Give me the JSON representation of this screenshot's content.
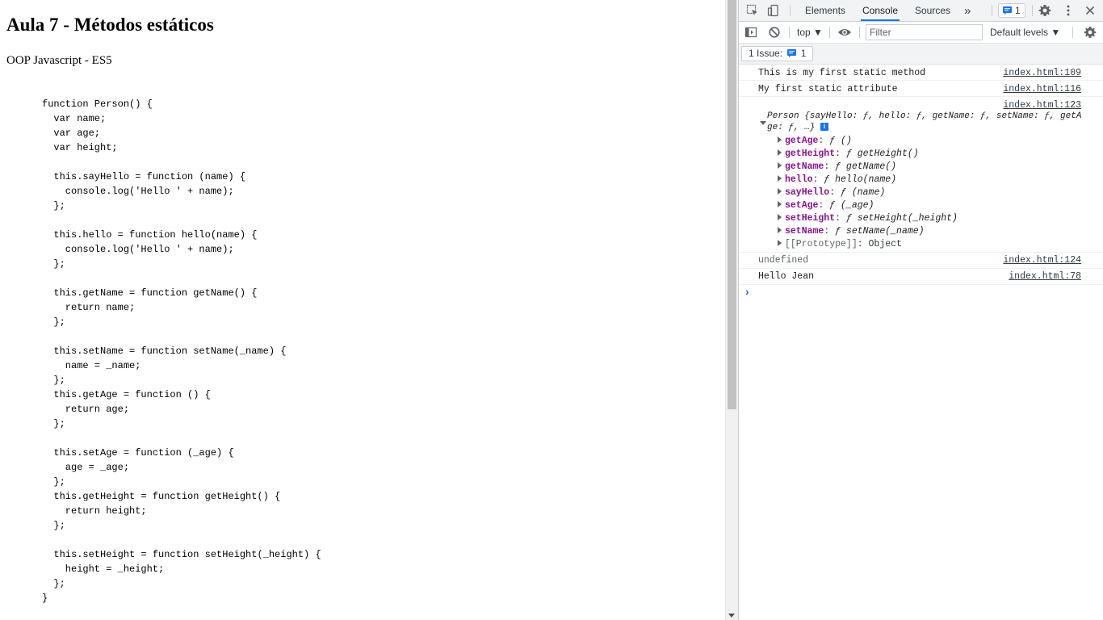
{
  "page": {
    "title": "Aula 7 - Métodos estáticos",
    "subtitle": "OOP Javascript - ES5",
    "code": "function Person() {\n  var name;\n  var age;\n  var height;\n\n  this.sayHello = function (name) {\n    console.log('Hello ' + name);\n  };\n\n  this.hello = function hello(name) {\n    console.log('Hello ' + name);\n  };\n\n  this.getName = function getName() {\n    return name;\n  };\n\n  this.setName = function setName(_name) {\n    name = _name;\n  };\n  this.getAge = function () {\n    return age;\n  };\n\n  this.setAge = function (_age) {\n    age = _age;\n  };\n  this.getHeight = function getHeight() {\n    return height;\n  };\n\n  this.setHeight = function setHeight(_height) {\n    height = _height;\n  };\n}"
  },
  "devtools": {
    "tabs": [
      "Elements",
      "Console",
      "Sources"
    ],
    "active_tab": "Console",
    "more_tabs": "»",
    "issues_badge_count": "1",
    "toolbar": {
      "context": "top ▼",
      "filter_placeholder": "Filter",
      "levels": "Default levels ▼"
    },
    "issues_bar": {
      "label": "1 Issue:",
      "count": "1"
    },
    "console": {
      "messages": [
        {
          "text": "This is my first static method",
          "source": "index.html:109"
        },
        {
          "text": "My first static attribute",
          "source": "index.html:116"
        }
      ],
      "object_message": {
        "source": "index.html:123",
        "summary_line1": "Person {sayHello: ƒ, hello: ƒ, getName: ƒ, setName: ƒ, getA",
        "summary_line2": "ge: ƒ, …}",
        "info_badge": "i",
        "properties": [
          {
            "key": "getAge",
            "value": "ƒ ()"
          },
          {
            "key": "getHeight",
            "value": "ƒ getHeight()"
          },
          {
            "key": "getName",
            "value": "ƒ getName()"
          },
          {
            "key": "hello",
            "value": "ƒ hello(name)"
          },
          {
            "key": "sayHello",
            "value": "ƒ (name)"
          },
          {
            "key": "setAge",
            "value": "ƒ (_age)"
          },
          {
            "key": "setHeight",
            "value": "ƒ setHeight(_height)"
          },
          {
            "key": "setName",
            "value": "ƒ setName(_name)"
          }
        ],
        "prototype": {
          "key": "[[Prototype]]",
          "value": "Object"
        }
      },
      "after_messages": [
        {
          "text": "undefined",
          "source": "index.html:124"
        },
        {
          "text": "Hello Jean",
          "source": "index.html:78"
        }
      ],
      "prompt_symbol": "›"
    }
  },
  "colors": {
    "accent": "#1a73e8",
    "property_key": "#881391",
    "toolbar_bg": "#f1f3f4"
  }
}
